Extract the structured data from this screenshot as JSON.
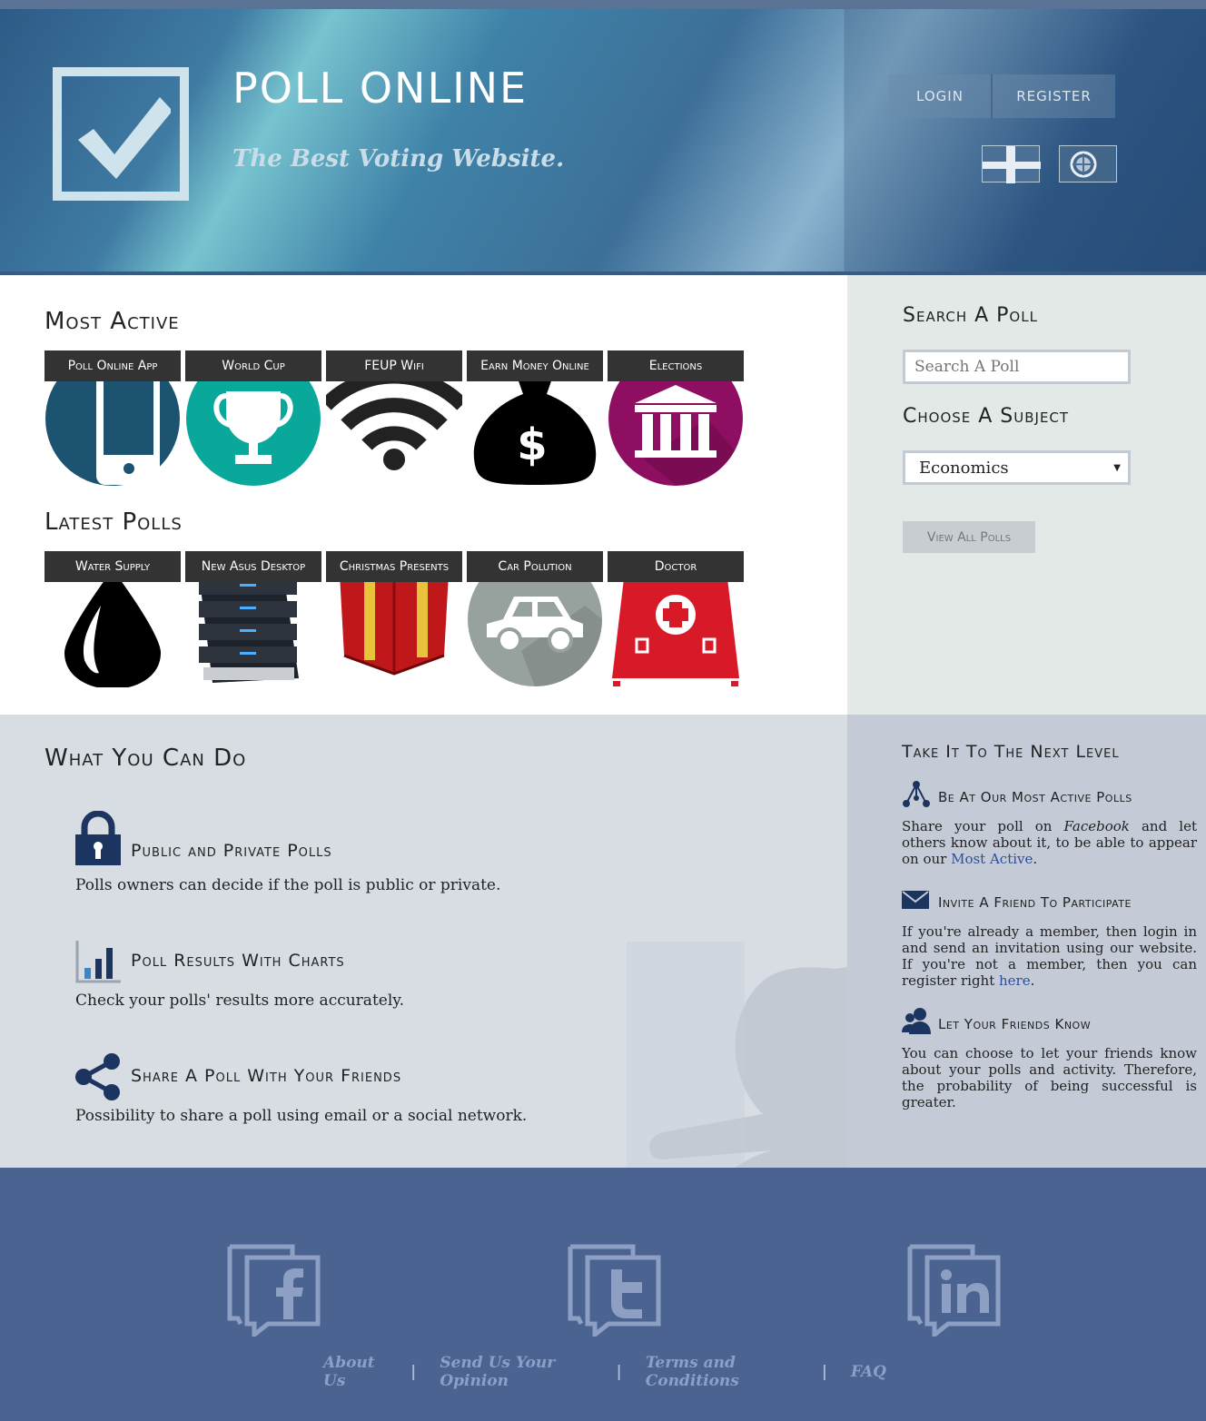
{
  "header": {
    "title": "POLL ONLINE",
    "slogan": "The Best Voting Website.",
    "login_label": "LOGIN",
    "register_label": "REGISTER",
    "languages": [
      "english-flag",
      "portuguese-flag"
    ]
  },
  "most_active": {
    "title": "Most Active",
    "items": [
      {
        "label": "Poll Online App",
        "icon": "phone-icon"
      },
      {
        "label": "World Cup",
        "icon": "trophy-icon"
      },
      {
        "label": "FEUP Wifi",
        "icon": "wifi-icon"
      },
      {
        "label": "Earn Money Online",
        "icon": "money-bag-icon"
      },
      {
        "label": "Elections",
        "icon": "bank-icon"
      }
    ]
  },
  "latest": {
    "title": "Latest Polls",
    "items": [
      {
        "label": "Water Supply",
        "icon": "water-drop-icon"
      },
      {
        "label": "New Asus Desktop",
        "icon": "server-icon"
      },
      {
        "label": "Christmas Presents",
        "icon": "gift-icon"
      },
      {
        "label": "Car Polution",
        "icon": "car-icon"
      },
      {
        "label": "Doctor",
        "icon": "medical-kit-icon"
      }
    ]
  },
  "sidebar": {
    "search_title": "Search A Poll",
    "search_placeholder": "Search A Poll",
    "subject_title": "Choose A Subject",
    "subject_value": "Economics",
    "view_all_label": "View All Polls"
  },
  "features": {
    "title": "What You Can Do",
    "items": [
      {
        "title": "Public and Private Polls",
        "text": "Polls owners can decide if the poll is public or private.",
        "icon": "lock-icon"
      },
      {
        "title": "Poll Results With Charts",
        "text": "Check your polls' results more accurately.",
        "icon": "bar-chart-icon"
      },
      {
        "title": "Share A Poll With Your Friends",
        "text": "Possibility to share a poll using email or a social network.",
        "icon": "share-icon"
      }
    ]
  },
  "next_level": {
    "title": "Take It To The Next Level",
    "items": [
      {
        "title": "Be At Our Most Active Polls",
        "icon": "network-icon",
        "text_a": "Share your poll on ",
        "text_em": "Facebook",
        "text_b": " and let others know about it, to be able to appear on our ",
        "link": "Most Active",
        "text_c": "."
      },
      {
        "title": "Invite A Friend To Participate",
        "icon": "envelope-icon",
        "text_a": "If you're already a member, then login in and send an invitation using our website. If you're not a member, then you can register right ",
        "link": "here",
        "text_c": "."
      },
      {
        "title": "Let Your Friends Know",
        "icon": "users-icon",
        "text_a": "You can choose to let your friends know about your polls and activity. Therefore, the probability of being successful is greater."
      }
    ]
  },
  "footer": {
    "social": [
      "facebook-icon",
      "twitter-icon",
      "linkedin-icon"
    ],
    "links": [
      "About Us",
      "Send Us Your Opinion",
      "Terms and Conditions",
      "FAQ"
    ],
    "separator": "|"
  }
}
